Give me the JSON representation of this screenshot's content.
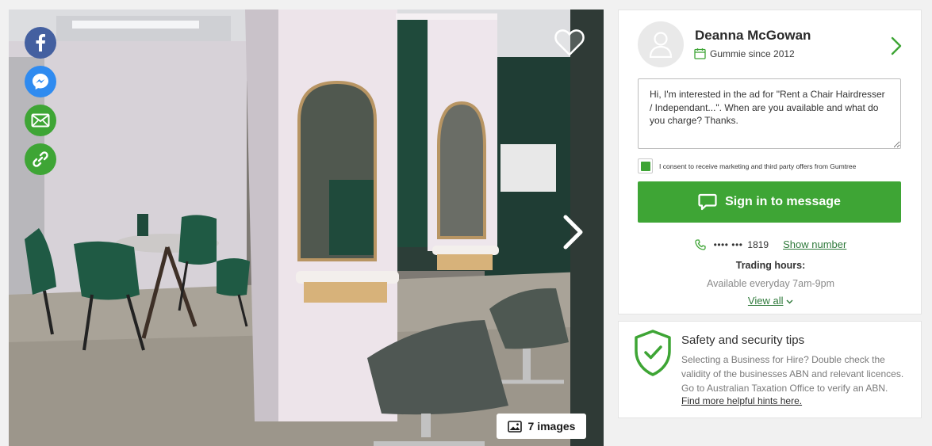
{
  "gallery": {
    "image_count_label": "7 images",
    "share_icons": [
      "facebook-icon",
      "messenger-icon",
      "email-icon",
      "link-icon"
    ],
    "colors": {
      "facebook": "#4460a0",
      "messenger": "#2f8bf0",
      "green": "#3ea535"
    }
  },
  "seller": {
    "name": "Deanna McGowan",
    "since": "Gummie since 2012"
  },
  "message": {
    "text": "Hi, I'm interested in the ad for \"Rent a Chair Hairdresser / Independant...\". When are you available and what do you charge? Thanks."
  },
  "consent": {
    "label": "I consent to receive marketing and third party offers from Gumtree",
    "checked": true
  },
  "actions": {
    "sign_in_label": "Sign in to message"
  },
  "contact": {
    "phone_masked": "•••• •••",
    "phone_suffix": "1819",
    "show_number": "Show number",
    "trading_hours_title": "Trading hours:",
    "trading_hours_value": "Available everyday 7am-9pm",
    "view_all": "View all"
  },
  "safety": {
    "title": "Safety and security tips",
    "body": "Selecting a Business for Hire? Double check the validity of the businesses ABN and relevant licences. Go to Australian Taxation Office to verify an ABN.",
    "link": "Find more helpful hints here."
  },
  "colors": {
    "brand_green": "#3ea535",
    "link_green": "#2f7a3b",
    "page_bg": "#f1f1f1"
  }
}
